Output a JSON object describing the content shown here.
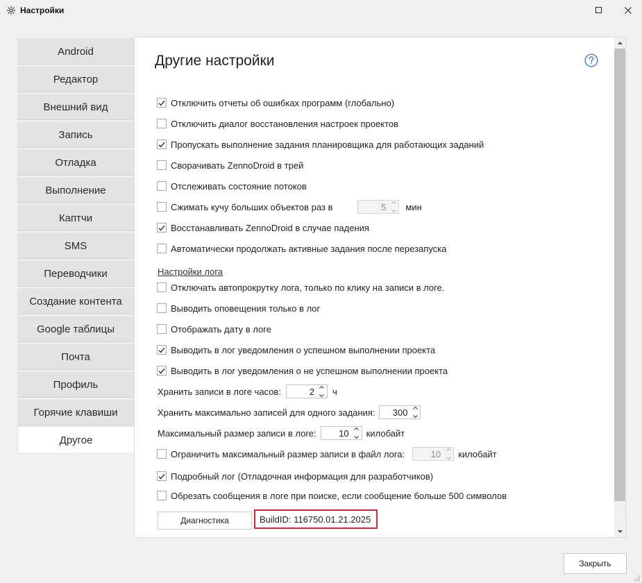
{
  "window": {
    "title": "Настройки",
    "icon": "gear-icon"
  },
  "sidebar": {
    "items": [
      {
        "label": "Android"
      },
      {
        "label": "Редактор"
      },
      {
        "label": "Внешний вид"
      },
      {
        "label": "Запись"
      },
      {
        "label": "Отладка"
      },
      {
        "label": "Выполнение"
      },
      {
        "label": "Каптчи"
      },
      {
        "label": "SMS"
      },
      {
        "label": "Переводчики"
      },
      {
        "label": "Создание контента"
      },
      {
        "label": "Google таблицы"
      },
      {
        "label": "Почта"
      },
      {
        "label": "Профиль"
      },
      {
        "label": "Горячие клавиши"
      },
      {
        "label": "Другое",
        "active": true
      }
    ]
  },
  "main": {
    "title": "Другие настройки",
    "help_icon": "question-circle-icon",
    "options": [
      {
        "label": "Отключить отчеты об ошибках программ (глобально)",
        "checked": true
      },
      {
        "label": "Отключить диалог восстановления настроек проектов",
        "checked": false
      },
      {
        "label": "Пропускать выполнение задания планировщика для работающих заданий",
        "checked": true
      },
      {
        "label": "Сворачивать ZennoDroid в трей",
        "checked": false
      },
      {
        "label": "Отслеживать состояние потоков",
        "checked": false
      },
      {
        "label": "Сжимать кучу больших объектов раз в",
        "checked": false,
        "value": "5",
        "unit": "мин"
      },
      {
        "label": "Восстанавливать ZennoDroid в случае падения",
        "checked": true
      },
      {
        "label": "Автоматически продолжать активные задания после перезапуска",
        "checked": false
      }
    ],
    "log_section_title": "Настройки лога",
    "log_options": [
      {
        "label": "Отключать автопрокрутку лога, только по клику на записи в логе.",
        "checked": false
      },
      {
        "label": "Выводить оповещения только в лог",
        "checked": false
      },
      {
        "label": "Отображать дату в логе",
        "checked": false
      },
      {
        "label": "Выводить в лог уведомления о успешном выполнении проекта",
        "checked": true
      },
      {
        "label": "Выводить в лог уведомления о не успешном выполнении проекта",
        "checked": true
      }
    ],
    "log_hours": {
      "label": "Хранить записи в логе часов:",
      "value": "2",
      "unit": "ч"
    },
    "log_max_records": {
      "label": "Хранить максимально записей для одного задания:",
      "value": "300"
    },
    "log_max_size": {
      "label": "Максимальный размер записи в логе:",
      "value": "10",
      "unit": "килобайт"
    },
    "log_file_limit": {
      "label": "Ограничить максимальный размер записи в файл лога:",
      "checked": false,
      "value": "10",
      "unit": "килобайт"
    },
    "verbose_log": {
      "label": "Подробный лог (Отладочная информация для разработчиков)",
      "checked": true
    },
    "trim_search": {
      "label": "Обрезать сообщения в логе при поиске, если сообщение больше 500 символов",
      "checked": false
    },
    "diagnostics_button": "Диагностика",
    "build_id": "BuildID: 116750.01.21.2025"
  },
  "footer": {
    "close_button": "Закрыть"
  },
  "colors": {
    "highlight": "#d6263b",
    "help": "#4a7bd0",
    "tab_bg": "#e3e3e3"
  }
}
